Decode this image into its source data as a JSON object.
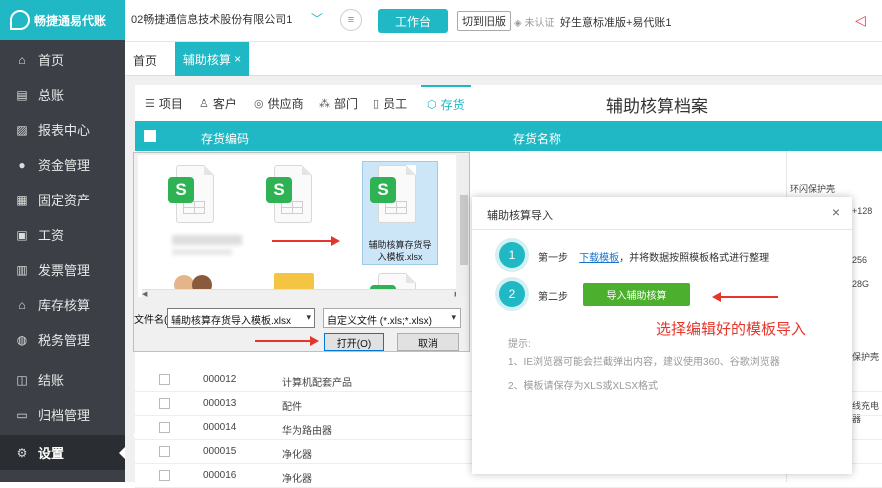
{
  "app": {
    "brand": "畅捷通易代账",
    "company": "02畅捷通信息技术股份有限公司1",
    "workbench": "工作台",
    "switch_old": "切到旧版",
    "cert": "未认证",
    "edition": "好生意标准版+易代账1"
  },
  "sidebar": {
    "items": [
      {
        "label": "首页",
        "icon": "home-icon"
      },
      {
        "label": "总账",
        "icon": "ledger-icon"
      },
      {
        "label": "报表中心",
        "icon": "chart-icon"
      },
      {
        "label": "资金管理",
        "icon": "money-icon"
      },
      {
        "label": "固定资产",
        "icon": "asset-icon"
      },
      {
        "label": "工资",
        "icon": "salary-icon"
      },
      {
        "label": "发票管理",
        "icon": "invoice-icon"
      },
      {
        "label": "库存核算",
        "icon": "warehouse-icon"
      },
      {
        "label": "税务管理",
        "icon": "tax-icon"
      },
      {
        "label": "结账",
        "icon": "close-account-icon"
      },
      {
        "label": "归档管理",
        "icon": "archive-icon"
      },
      {
        "label": "设置",
        "icon": "gear-icon"
      }
    ]
  },
  "tabs": {
    "home": "首页",
    "aux": "辅助核算",
    "close": "×"
  },
  "aux_tabs": [
    {
      "label": "项目",
      "icon": "list-icon"
    },
    {
      "label": "客户",
      "icon": "user-icon"
    },
    {
      "label": "供应商",
      "icon": "supplier-icon"
    },
    {
      "label": "部门",
      "icon": "org-icon"
    },
    {
      "label": "员工",
      "icon": "badge-icon"
    },
    {
      "label": "存货",
      "icon": "box-icon"
    }
  ],
  "archive_title": "辅助核算档案",
  "table": {
    "col_code": "存货编码",
    "col_name": "存货名称",
    "rows": [
      {
        "code": "000012",
        "name": "计算机配套产品"
      },
      {
        "code": "000013",
        "name": "配件"
      },
      {
        "code": "000014",
        "name": "华为路由器"
      },
      {
        "code": "000015",
        "name": "净化器"
      },
      {
        "code": "000016",
        "name": "净化器"
      }
    ],
    "right_cells": [
      "环闪保护壳",
      "+128",
      "256",
      "28G",
      "保护壳",
      "线充电器"
    ]
  },
  "file_dialog": {
    "selected_file": "辅助核算存货导入模板.xlsx",
    "filename_label": "文件名(N):",
    "filename_value": "辅助核算存货导入模板.xlsx",
    "filetype": "自定义文件 (*.xls;*.xlsx)",
    "open": "打开(O)",
    "cancel": "取消"
  },
  "import_dialog": {
    "title": "辅助核算导入",
    "close": "×",
    "step1_num": "1",
    "step1_label": "第一步",
    "step1_link": "下载模板",
    "step1_text": "，并将数据按照模板格式进行整理",
    "step2_num": "2",
    "step2_label": "第二步",
    "import_button": "导入辅助核算",
    "tip_title": "提示:",
    "tip1": "1、IE浏览器可能会拦截弹出内容，建议使用360、谷歌浏览器",
    "tip2": "2、模板请保存为XLS或XLSX格式"
  },
  "annotation": "选择编辑好的模板导入",
  "colors": {
    "accent": "#1fb8c4",
    "sidebar": "#3c4046",
    "import_button": "#4caf2e",
    "annotation": "#e5362b"
  }
}
